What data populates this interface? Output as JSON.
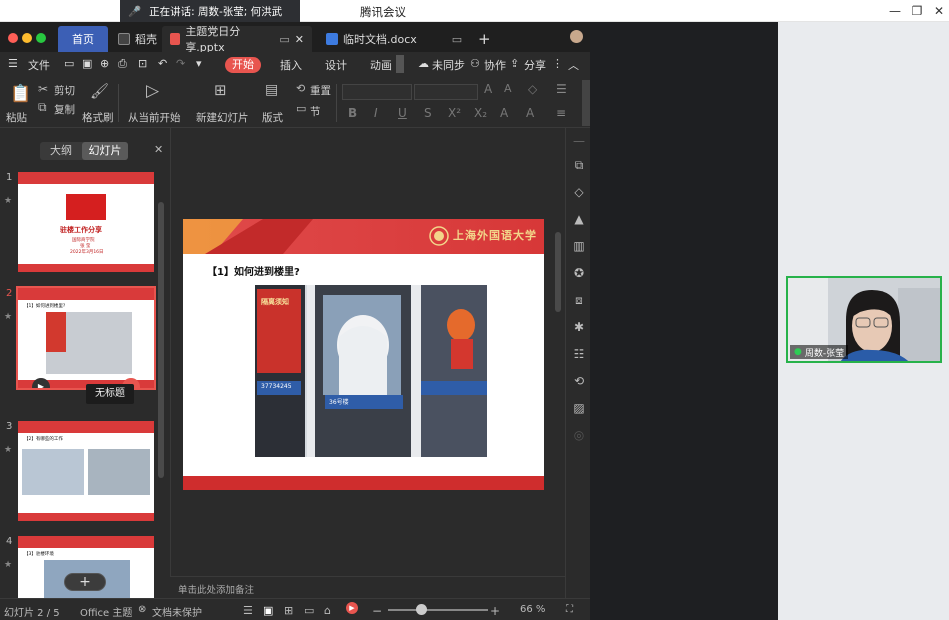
{
  "meeting": {
    "speaking": "正在讲话: 周数-张莹; 何洪武",
    "title": "腾讯会议",
    "participant_name": "周数-张莹"
  },
  "wps": {
    "tabs": {
      "home": "首页",
      "docer": "稻壳",
      "pptx": "主题党日分享.pptx",
      "docx": "临时文档.docx"
    },
    "menu": {
      "file": "文件",
      "start": "开始",
      "insert": "插入",
      "design": "设计",
      "animation": "动画",
      "unsynced": "未同步",
      "collab": "协作",
      "share": "分享"
    },
    "ribbon": {
      "paste": "粘贴",
      "cut": "剪切",
      "copy": "复制",
      "format_painter": "格式刷",
      "play_from_current": "从当前开始",
      "new_slide": "新建幻灯片",
      "layout": "版式",
      "section": "节",
      "reset": "重置"
    },
    "panel": {
      "outline": "大纲",
      "slides": "幻灯片",
      "tooltip": "无标题"
    },
    "thumbs": [
      {
        "num": "1",
        "title": "驻楼工作分享",
        "sub1": "国际商学院",
        "sub2": "张 莹",
        "sub3": "2022年3月16日"
      },
      {
        "num": "2",
        "title": "【1】如何进到楼里?"
      },
      {
        "num": "3",
        "title": "【2】有哪些的工作"
      },
      {
        "num": "4",
        "title": "【3】驻楼环境"
      }
    ],
    "slide": {
      "title": "【1】如何进到楼里?",
      "logo_text": "上海外国语大学",
      "notice_title": "隔离须知",
      "phone": "37734245",
      "building": "36号楼"
    },
    "notes_placeholder": "单击此处添加备注",
    "status": {
      "slide_count": "幻灯片 2 / 5",
      "theme": "Office 主题",
      "protect": "文档未保护",
      "zoom": "66 %"
    }
  }
}
